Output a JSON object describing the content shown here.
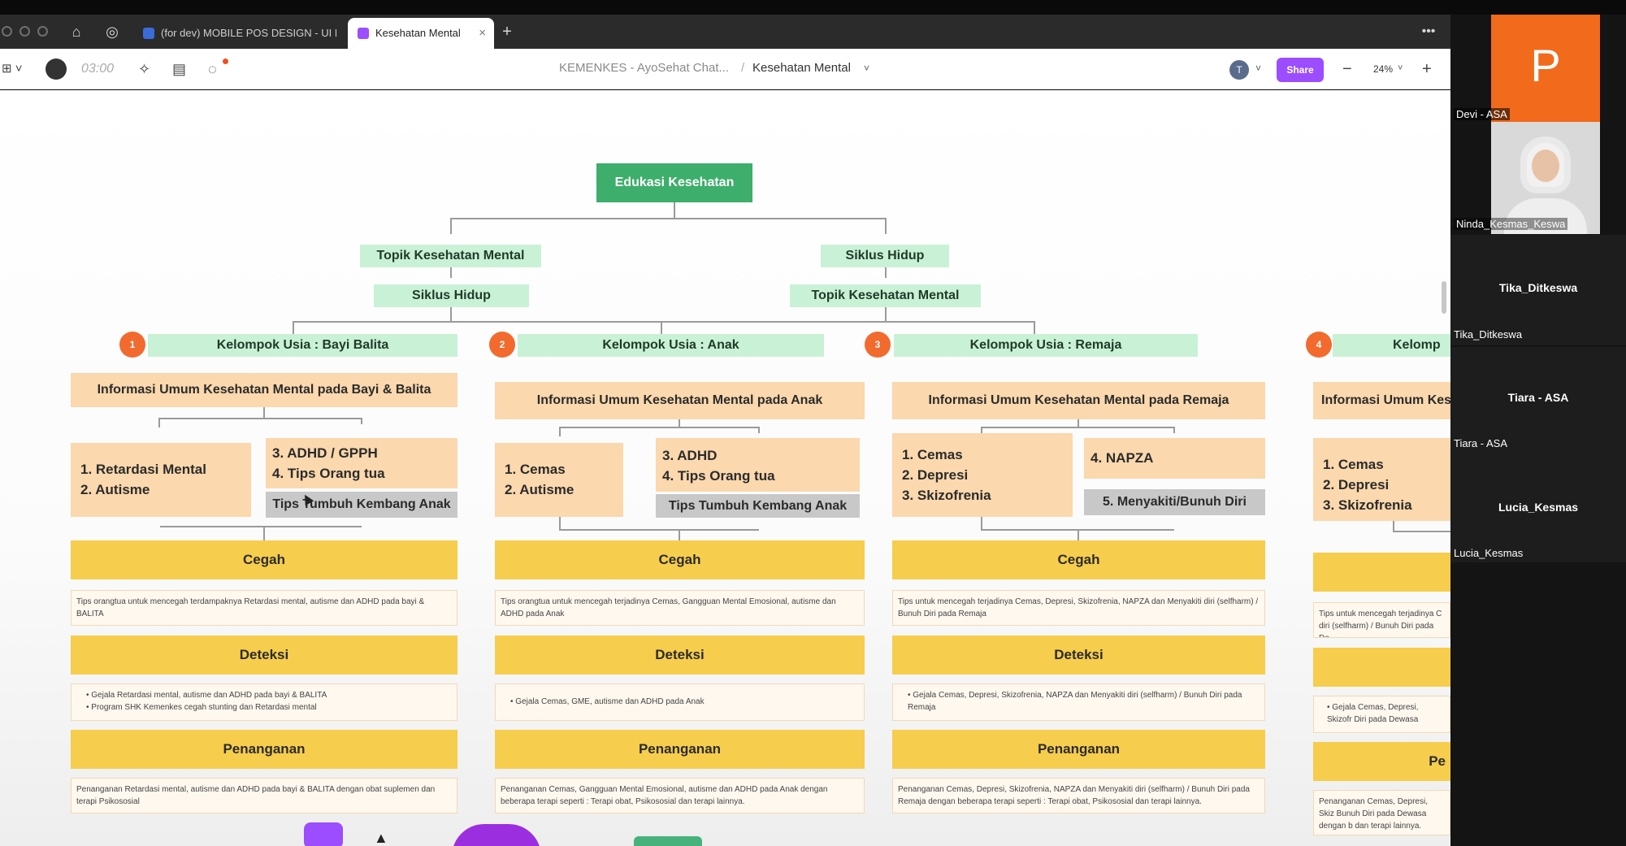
{
  "tabs": [
    {
      "label": "(for dev) MOBILE POS DESIGN - UI LI"
    },
    {
      "label": "Kesehatan Mental"
    }
  ],
  "toolbar": {
    "timer": "03:00",
    "breadcrumb_project": "KEMENKES - AyoSehat Chat...",
    "breadcrumb_sep": "/",
    "breadcrumb_page": "Kesehatan Mental",
    "avatar": "T",
    "share_label": "Share",
    "zoom": "24%"
  },
  "diagram": {
    "root": "Edukasi Kesehatan",
    "left_branch": {
      "first": "Topik Kesehatan Mental",
      "second": "Siklus Hidup"
    },
    "right_branch": {
      "first": "Siklus Hidup",
      "second": "Topik Kesehatan Mental"
    },
    "columns": [
      {
        "num": "1",
        "group": "Kelompok Usia : Bayi Balita",
        "info": "Informasi Umum Kesehatan Mental pada Bayi & Balita",
        "list_a": [
          "1. Retardasi Mental",
          "2. Autisme"
        ],
        "list_b": [
          "3. ADHD / GPPH",
          "4. Tips Orang tua"
        ],
        "grey": "Tips Tumbuh Kembang Anak",
        "cegah": "Cegah",
        "cegah_note": "Tips orangtua untuk mencegah terdampaknya Retardasi mental, autisme dan ADHD pada bayi & BALITA",
        "deteksi": "Deteksi",
        "deteksi_notes": [
          "Gejala Retardasi mental, autisme dan ADHD pada bayi & BALITA",
          "Program SHK Kemenkes cegah stunting dan Retardasi mental"
        ],
        "penanganan": "Penanganan",
        "penanganan_note": "Penanganan Retardasi mental, autisme dan ADHD pada bayi & BALITA dengan obat suplemen dan terapi Psikososial"
      },
      {
        "num": "2",
        "group": "Kelompok Usia : Anak",
        "info": "Informasi Umum Kesehatan Mental pada Anak",
        "list_a": [
          "1. Cemas",
          "2. Autisme"
        ],
        "list_b": [
          "3. ADHD",
          "4. Tips Orang tua"
        ],
        "grey": "Tips Tumbuh Kembang Anak",
        "cegah": "Cegah",
        "cegah_note": "Tips orangtua untuk mencegah terjadinya Cemas, Gangguan Mental Emosional, autisme dan ADHD pada Anak",
        "deteksi": "Deteksi",
        "deteksi_notes": [
          "Gejala Cemas, GME, autisme dan ADHD pada Anak"
        ],
        "penanganan": "Penanganan",
        "penanganan_note": "Penanganan Cemas, Gangguan Mental Emosional, autisme dan ADHD pada Anak dengan beberapa terapi seperti : Terapi obat, Psikososial dan terapi lainnya."
      },
      {
        "num": "3",
        "group": "Kelompok Usia : Remaja",
        "info": "Informasi Umum Kesehatan Mental pada Remaja",
        "list_a": [
          "1. Cemas",
          "2. Depresi",
          "3. Skizofrenia"
        ],
        "list_b": [
          "4. NAPZA"
        ],
        "grey": "5. Menyakiti/Bunuh Diri",
        "cegah": "Cegah",
        "cegah_note": "Tips untuk mencegah terjadinya Cemas, Depresi, Skizofrenia, NAPZA dan Menyakiti diri (selfharm) / Bunuh Diri pada Remaja",
        "deteksi": "Deteksi",
        "deteksi_notes": [
          "Gejala Cemas, Depresi, Skizofrenia, NAPZA dan Menyakiti diri (selfharm) / Bunuh Diri pada Remaja"
        ],
        "penanganan": "Penanganan",
        "penanganan_note": "Penanganan Cemas, Depresi, Skizofrenia, NAPZA dan Menyakiti diri (selfharm) / Bunuh Diri pada Remaja dengan beberapa terapi seperti : Terapi obat, Psikososial dan terapi lainnya."
      },
      {
        "num": "4",
        "group": "Kelomp",
        "info": "Informasi Umum Kes",
        "list_a": [
          "1. Cemas",
          "2. Depresi",
          "3. Skizofrenia"
        ],
        "cegah_note": "Tips untuk mencegah terjadinya C diri (selfharm) / Bunuh Diri pada De",
        "deteksi_note": "Gejala Cemas, Depresi, Skizofr Diri pada Dewasa",
        "penanganan": "Pe",
        "penanganan_note": "Penanganan Cemas, Depresi, Skiz Bunuh Diri pada Dewasa dengan b dan terapi lainnya."
      }
    ]
  },
  "participants": [
    {
      "name": "Devi - ASA",
      "initial": "P"
    },
    {
      "name": "Ninda_Kesmas_Keswa"
    },
    {
      "name": "Tika_Ditkeswa",
      "label": "Tika_Ditkeswa"
    },
    {
      "name": "Tiara - ASA",
      "label": "Tiara - ASA"
    },
    {
      "name": "Lucia_Kesmas",
      "label": "Lucia_Kesmas"
    }
  ],
  "colors": {
    "accent": "#9b4dff",
    "root_green": "#3dae6b",
    "light_green": "#c9f1d6",
    "peach": "#fbd8ad",
    "yellow": "#f6cd4c",
    "badge_orange": "#f26a2e",
    "participant_orange": "#f26a1b"
  }
}
